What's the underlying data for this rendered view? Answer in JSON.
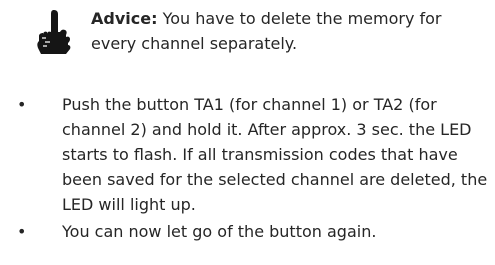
{
  "advice": {
    "icon": "hand-pointing-icon",
    "label": "Advice:",
    "text": " You have to delete the memory for every channel separately."
  },
  "steps": [
    {
      "bullet": "•",
      "text": "Push the button TA1 (for channel 1) or TA2 (for channel 2) and hold it. After approx. 3 sec. the LED starts to flash. If all transmission codes that have been saved for the selected channel are deleted, the LED will light up."
    },
    {
      "bullet": "•",
      "text": "You can now let go of the button again."
    }
  ]
}
